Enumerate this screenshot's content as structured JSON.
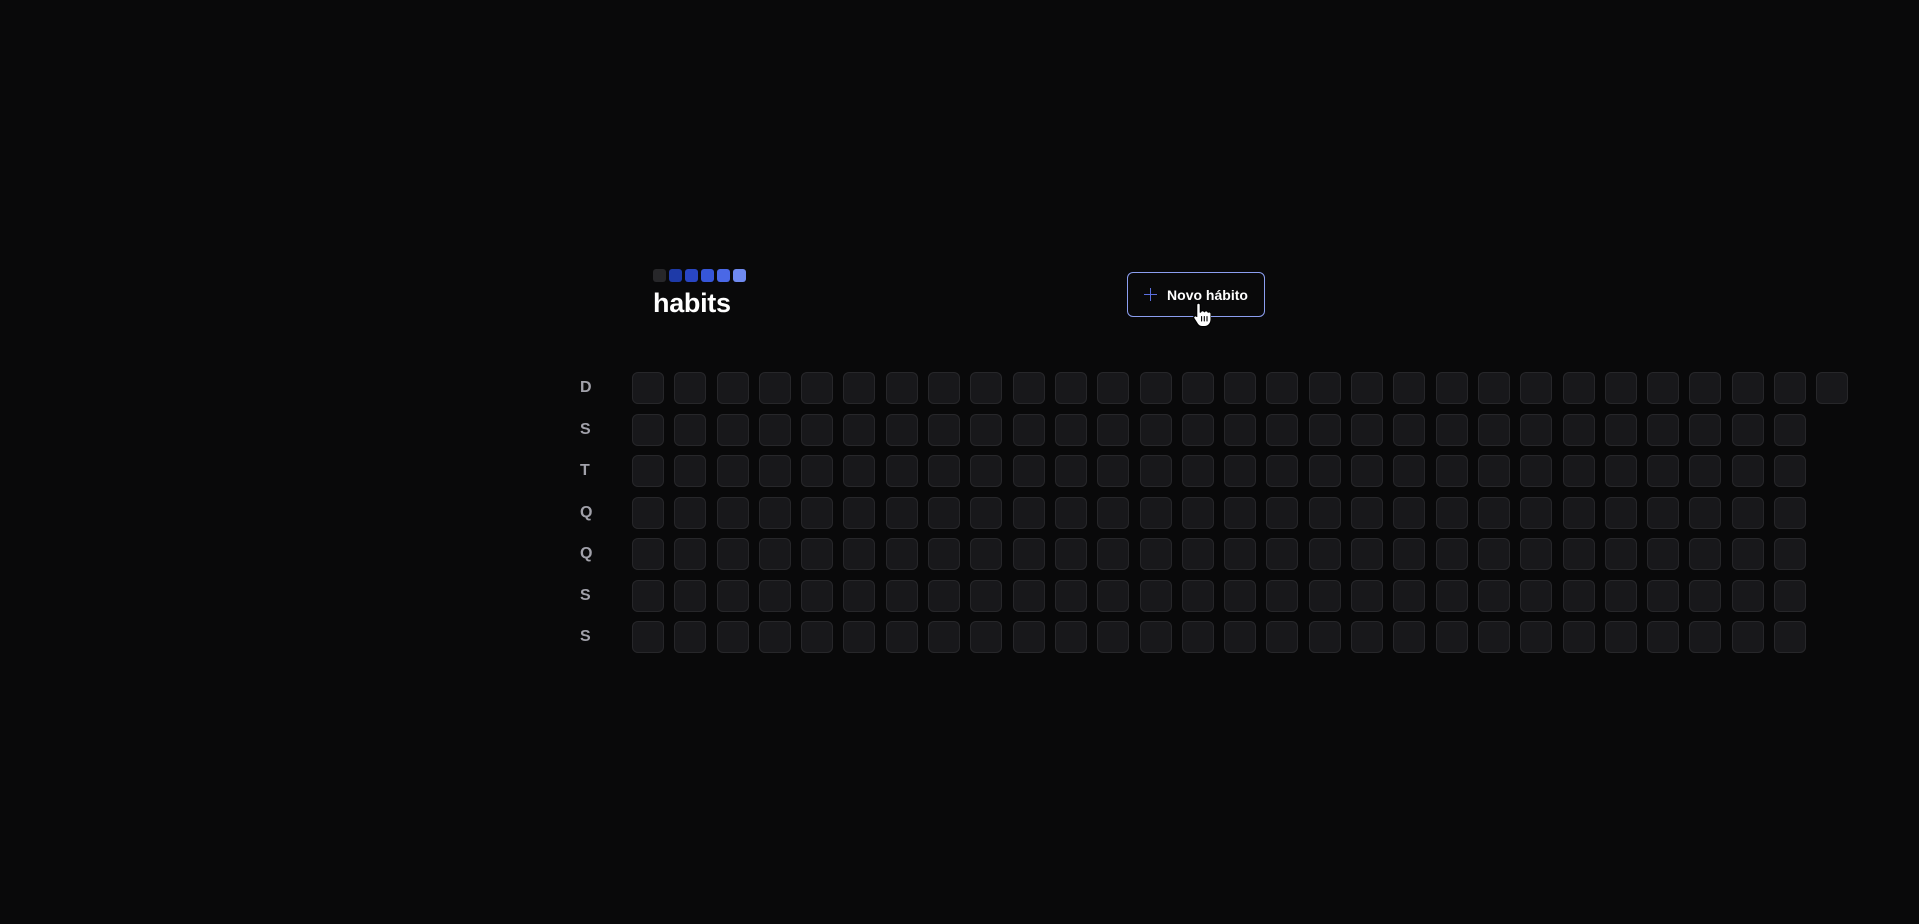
{
  "app": {
    "title": "habits",
    "logo_colors": [
      "#27272a",
      "#1e3aa8",
      "#2946c4",
      "#3656d9",
      "#4a68e6",
      "#6f8af0"
    ]
  },
  "header": {
    "new_habit_label": "Novo hábito",
    "new_habit_icon": "plus-icon"
  },
  "summary": {
    "weekdays": [
      "D",
      "S",
      "T",
      "Q",
      "Q",
      "S",
      "S"
    ],
    "total_days": 197,
    "day_color": "#18181b",
    "day_border": "#27272a"
  },
  "colors": {
    "background": "#09090a",
    "accent": "#8b9ef0",
    "weekday_text": "#a1a1aa"
  }
}
